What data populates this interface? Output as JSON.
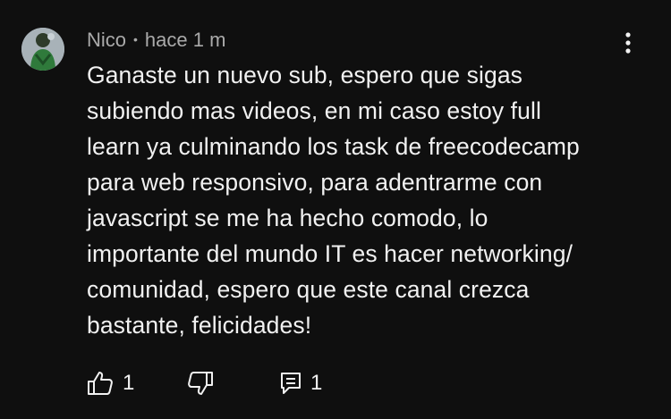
{
  "comment": {
    "author": "Nico",
    "separator": "•",
    "time": "hace 1 m",
    "text_lines": [
      "Ganaste un nuevo sub, espero que sigas",
      "subiendo mas videos, en mi caso estoy full",
      "learn ya culminando los task de freecodecamp",
      "para web responsivo, para adentrarme con",
      "javascript se me ha hecho comodo, lo",
      "importante del mundo IT es hacer networking/",
      "comunidad, espero que este canal crezca",
      "bastante, felicidades!"
    ],
    "likes": "1",
    "replies": "1"
  },
  "icons": {
    "avatar": "avatar",
    "more": "more-vertical-icon",
    "like": "thumbs-up-icon",
    "dislike": "thumbs-down-icon",
    "reply": "comment-reply-icon"
  },
  "colors": {
    "background": "#0f0f0f",
    "text": "#f1f1f1",
    "meta": "#aaaaaa"
  }
}
